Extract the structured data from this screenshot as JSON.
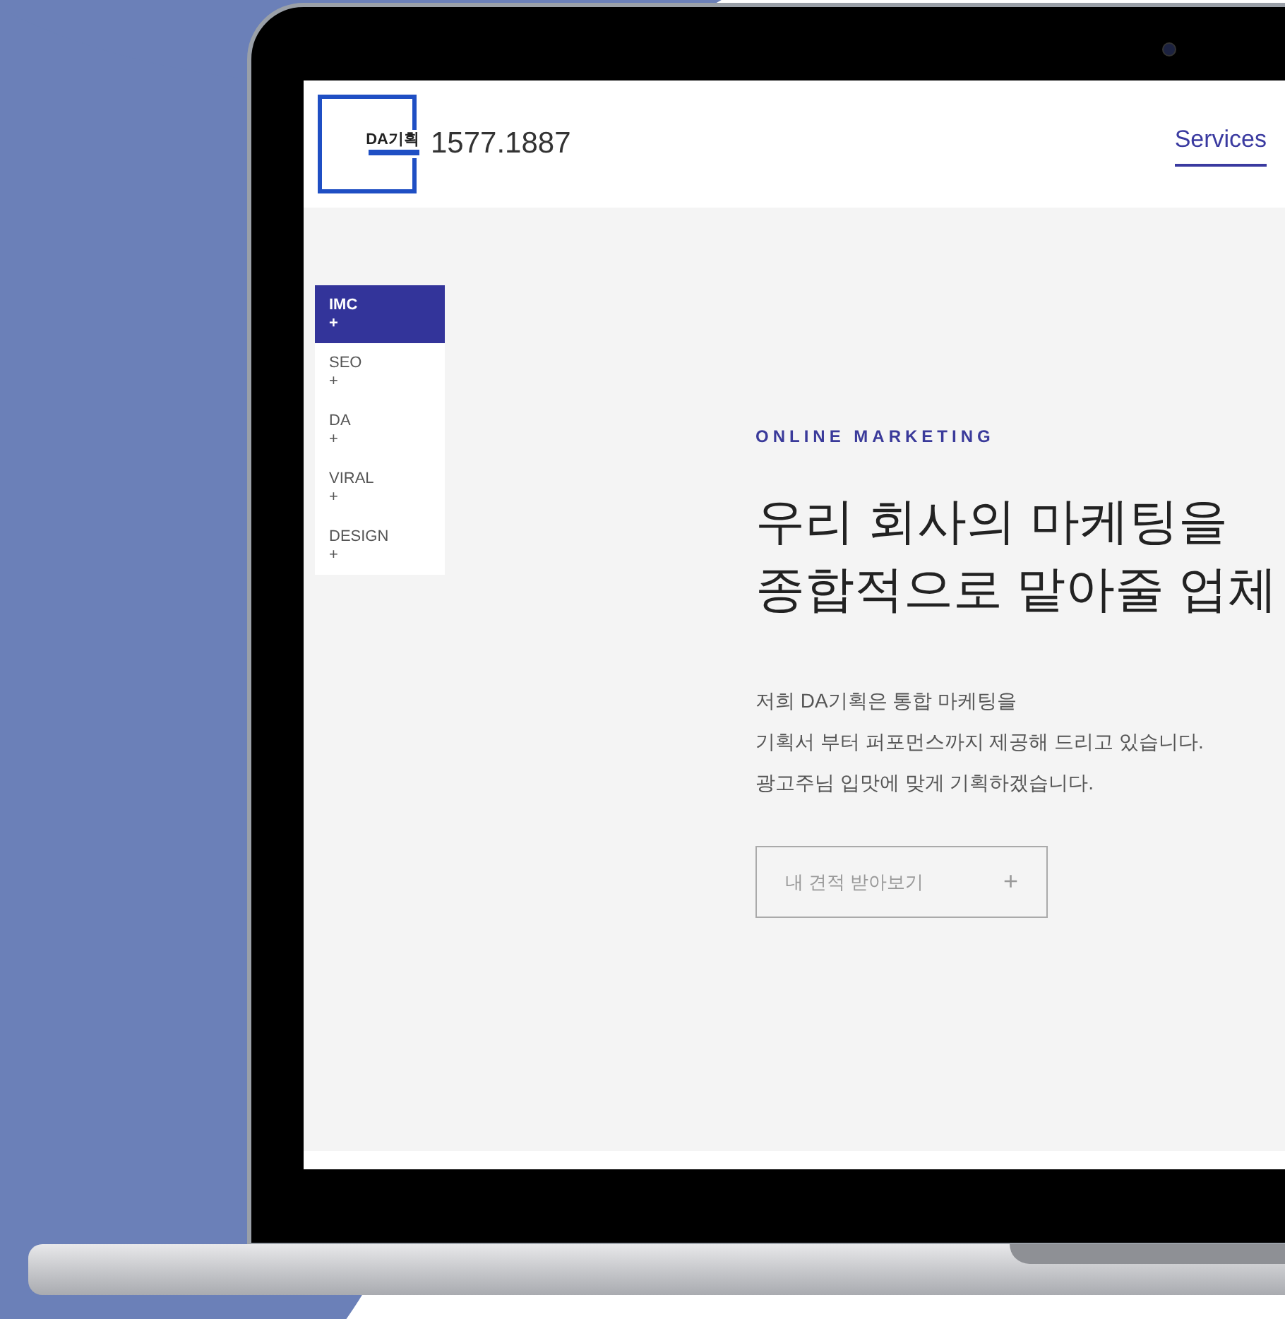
{
  "header": {
    "logo": "DA기획",
    "phone": "1577.1887",
    "nav": [
      {
        "label": "Services",
        "selected": true
      }
    ]
  },
  "sidebar": {
    "items": [
      {
        "label": "IMC",
        "icon": "+",
        "selected": true
      },
      {
        "label": "SEO",
        "icon": "+",
        "selected": false
      },
      {
        "label": "DA",
        "icon": "+",
        "selected": false
      },
      {
        "label": "VIRAL",
        "icon": "+",
        "selected": false
      },
      {
        "label": "DESIGN",
        "icon": "+",
        "selected": false
      }
    ]
  },
  "hero": {
    "eyebrow": "ONLINE MARKETING",
    "headline": [
      "우리 회사의 마케팅을",
      "종합적으로 맡아줄 업체"
    ],
    "body": [
      "저희 DA기획은 통합 마케팅을",
      "기획서 부터 퍼포먼스까지 제공해 드리고 있습니다.",
      "광고주님 입맛에 맞게 기획하겠습니다."
    ],
    "button": {
      "label": "내 견적 받아보기",
      "icon": "+"
    }
  }
}
